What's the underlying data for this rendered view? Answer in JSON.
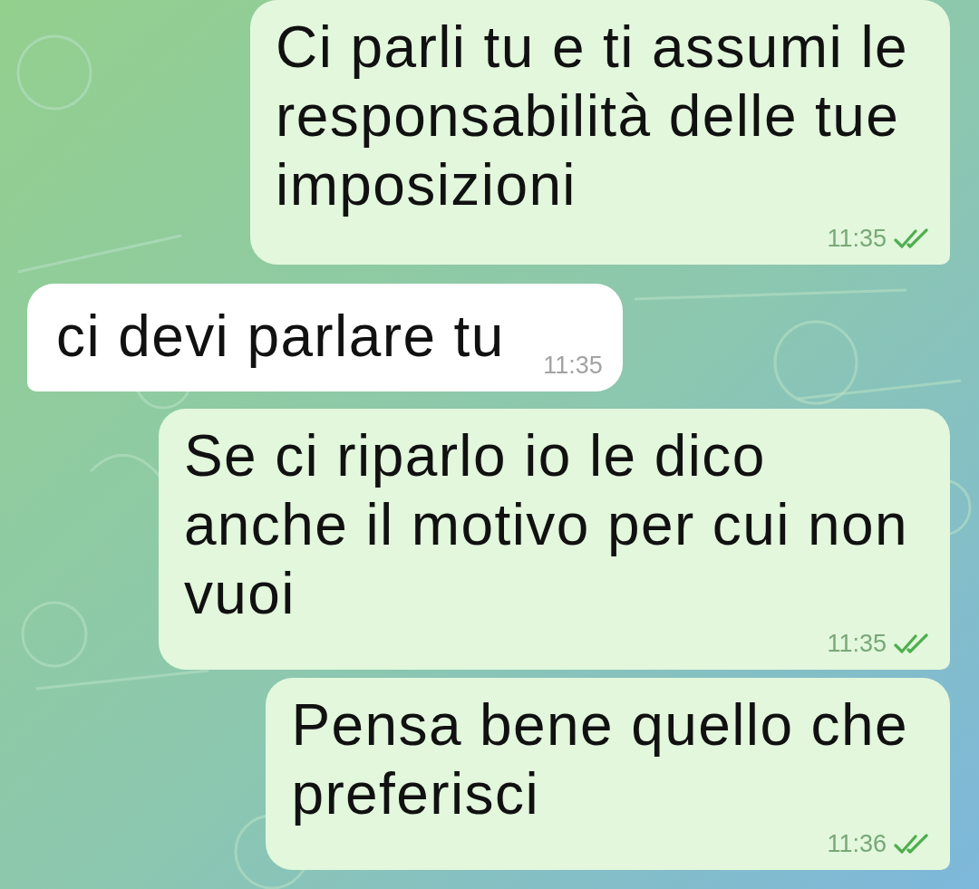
{
  "messages": [
    {
      "kind": "out",
      "text": "Ci parli tu e ti assumi le\nresponsabilità delle tue\nimposizioni",
      "time": "11:35",
      "read": true
    },
    {
      "kind": "in",
      "text": "ci devi parlare tu",
      "time": "11:35"
    },
    {
      "kind": "out",
      "text": "Se ci riparlo io le dico\nanche il motivo per cui non\nvuoi",
      "time": "11:35",
      "read": true
    },
    {
      "kind": "out",
      "text": "Pensa bene quello che\npreferisci",
      "time": "11:36",
      "read": true
    }
  ]
}
